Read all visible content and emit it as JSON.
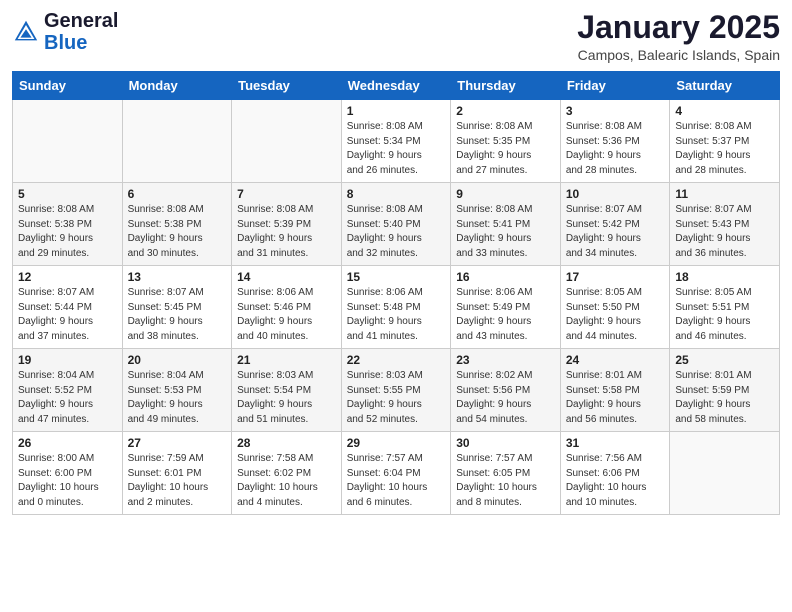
{
  "header": {
    "logo_general": "General",
    "logo_blue": "Blue",
    "month_title": "January 2025",
    "location": "Campos, Balearic Islands, Spain"
  },
  "weekdays": [
    "Sunday",
    "Monday",
    "Tuesday",
    "Wednesday",
    "Thursday",
    "Friday",
    "Saturday"
  ],
  "weeks": [
    [
      {
        "day": "",
        "info": ""
      },
      {
        "day": "",
        "info": ""
      },
      {
        "day": "",
        "info": ""
      },
      {
        "day": "1",
        "info": "Sunrise: 8:08 AM\nSunset: 5:34 PM\nDaylight: 9 hours\nand 26 minutes."
      },
      {
        "day": "2",
        "info": "Sunrise: 8:08 AM\nSunset: 5:35 PM\nDaylight: 9 hours\nand 27 minutes."
      },
      {
        "day": "3",
        "info": "Sunrise: 8:08 AM\nSunset: 5:36 PM\nDaylight: 9 hours\nand 28 minutes."
      },
      {
        "day": "4",
        "info": "Sunrise: 8:08 AM\nSunset: 5:37 PM\nDaylight: 9 hours\nand 28 minutes."
      }
    ],
    [
      {
        "day": "5",
        "info": "Sunrise: 8:08 AM\nSunset: 5:38 PM\nDaylight: 9 hours\nand 29 minutes."
      },
      {
        "day": "6",
        "info": "Sunrise: 8:08 AM\nSunset: 5:38 PM\nDaylight: 9 hours\nand 30 minutes."
      },
      {
        "day": "7",
        "info": "Sunrise: 8:08 AM\nSunset: 5:39 PM\nDaylight: 9 hours\nand 31 minutes."
      },
      {
        "day": "8",
        "info": "Sunrise: 8:08 AM\nSunset: 5:40 PM\nDaylight: 9 hours\nand 32 minutes."
      },
      {
        "day": "9",
        "info": "Sunrise: 8:08 AM\nSunset: 5:41 PM\nDaylight: 9 hours\nand 33 minutes."
      },
      {
        "day": "10",
        "info": "Sunrise: 8:07 AM\nSunset: 5:42 PM\nDaylight: 9 hours\nand 34 minutes."
      },
      {
        "day": "11",
        "info": "Sunrise: 8:07 AM\nSunset: 5:43 PM\nDaylight: 9 hours\nand 36 minutes."
      }
    ],
    [
      {
        "day": "12",
        "info": "Sunrise: 8:07 AM\nSunset: 5:44 PM\nDaylight: 9 hours\nand 37 minutes."
      },
      {
        "day": "13",
        "info": "Sunrise: 8:07 AM\nSunset: 5:45 PM\nDaylight: 9 hours\nand 38 minutes."
      },
      {
        "day": "14",
        "info": "Sunrise: 8:06 AM\nSunset: 5:46 PM\nDaylight: 9 hours\nand 40 minutes."
      },
      {
        "day": "15",
        "info": "Sunrise: 8:06 AM\nSunset: 5:48 PM\nDaylight: 9 hours\nand 41 minutes."
      },
      {
        "day": "16",
        "info": "Sunrise: 8:06 AM\nSunset: 5:49 PM\nDaylight: 9 hours\nand 43 minutes."
      },
      {
        "day": "17",
        "info": "Sunrise: 8:05 AM\nSunset: 5:50 PM\nDaylight: 9 hours\nand 44 minutes."
      },
      {
        "day": "18",
        "info": "Sunrise: 8:05 AM\nSunset: 5:51 PM\nDaylight: 9 hours\nand 46 minutes."
      }
    ],
    [
      {
        "day": "19",
        "info": "Sunrise: 8:04 AM\nSunset: 5:52 PM\nDaylight: 9 hours\nand 47 minutes."
      },
      {
        "day": "20",
        "info": "Sunrise: 8:04 AM\nSunset: 5:53 PM\nDaylight: 9 hours\nand 49 minutes."
      },
      {
        "day": "21",
        "info": "Sunrise: 8:03 AM\nSunset: 5:54 PM\nDaylight: 9 hours\nand 51 minutes."
      },
      {
        "day": "22",
        "info": "Sunrise: 8:03 AM\nSunset: 5:55 PM\nDaylight: 9 hours\nand 52 minutes."
      },
      {
        "day": "23",
        "info": "Sunrise: 8:02 AM\nSunset: 5:56 PM\nDaylight: 9 hours\nand 54 minutes."
      },
      {
        "day": "24",
        "info": "Sunrise: 8:01 AM\nSunset: 5:58 PM\nDaylight: 9 hours\nand 56 minutes."
      },
      {
        "day": "25",
        "info": "Sunrise: 8:01 AM\nSunset: 5:59 PM\nDaylight: 9 hours\nand 58 minutes."
      }
    ],
    [
      {
        "day": "26",
        "info": "Sunrise: 8:00 AM\nSunset: 6:00 PM\nDaylight: 10 hours\nand 0 minutes."
      },
      {
        "day": "27",
        "info": "Sunrise: 7:59 AM\nSunset: 6:01 PM\nDaylight: 10 hours\nand 2 minutes."
      },
      {
        "day": "28",
        "info": "Sunrise: 7:58 AM\nSunset: 6:02 PM\nDaylight: 10 hours\nand 4 minutes."
      },
      {
        "day": "29",
        "info": "Sunrise: 7:57 AM\nSunset: 6:04 PM\nDaylight: 10 hours\nand 6 minutes."
      },
      {
        "day": "30",
        "info": "Sunrise: 7:57 AM\nSunset: 6:05 PM\nDaylight: 10 hours\nand 8 minutes."
      },
      {
        "day": "31",
        "info": "Sunrise: 7:56 AM\nSunset: 6:06 PM\nDaylight: 10 hours\nand 10 minutes."
      },
      {
        "day": "",
        "info": ""
      }
    ]
  ]
}
